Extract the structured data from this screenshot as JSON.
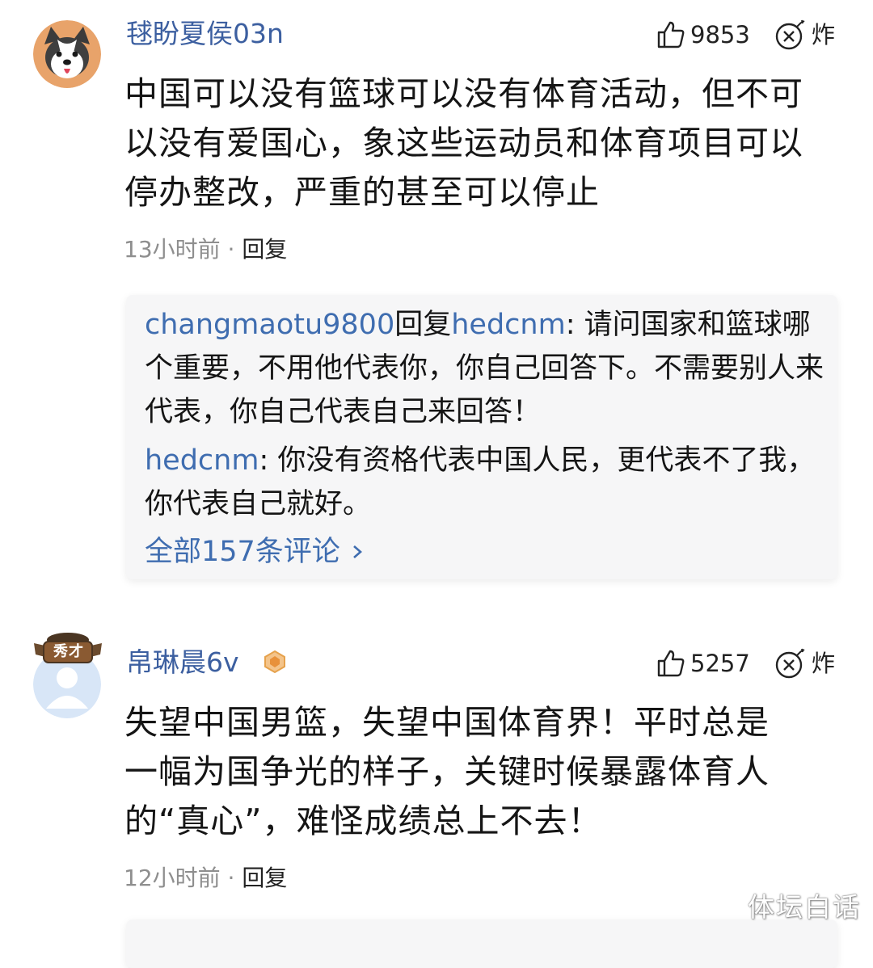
{
  "comments": [
    {
      "username": "毬盼夏侯03n",
      "likes": "9853",
      "bomb_label": "炸",
      "text": "中国可以没有篮球可以没有体育活动，但不可以没有爱国心，象这些运动员和体育项目可以停办整改，严重的甚至可以停止",
      "time": "13小时前",
      "separator": " · ",
      "reply_label": "回复",
      "replies": [
        {
          "author": "changmaotu9800",
          "reply_word": "回复",
          "target": "hedcnm",
          "text": ": 请问国家和篮球哪个重要，不用他代表你，你自己回答下。不需要别人来代表，你自己代表自己来回答！"
        },
        {
          "author": "hedcnm",
          "text": ": 你没有资格代表中国人民，更代表不了我，你代表自己就好。"
        }
      ],
      "all_comments_label": "全部157条评论"
    },
    {
      "username": "帛琳晨6v",
      "avatar_badge": "秀才",
      "likes": "5257",
      "bomb_label": "炸",
      "text": "失望中国男篮，失望中国体育界！平时总是一幅为国争光的样子，关键时候暴露体育人的“真心”，难怪成绩总上不去！",
      "time": "12小时前",
      "separator": " · ",
      "reply_label": "回复"
    }
  ],
  "watermark": "体坛白话",
  "colors": {
    "username": "#3c5fa0",
    "link": "#3f6db0",
    "meta": "#8e8e8e",
    "reply_bg": "#f6f6f7"
  }
}
